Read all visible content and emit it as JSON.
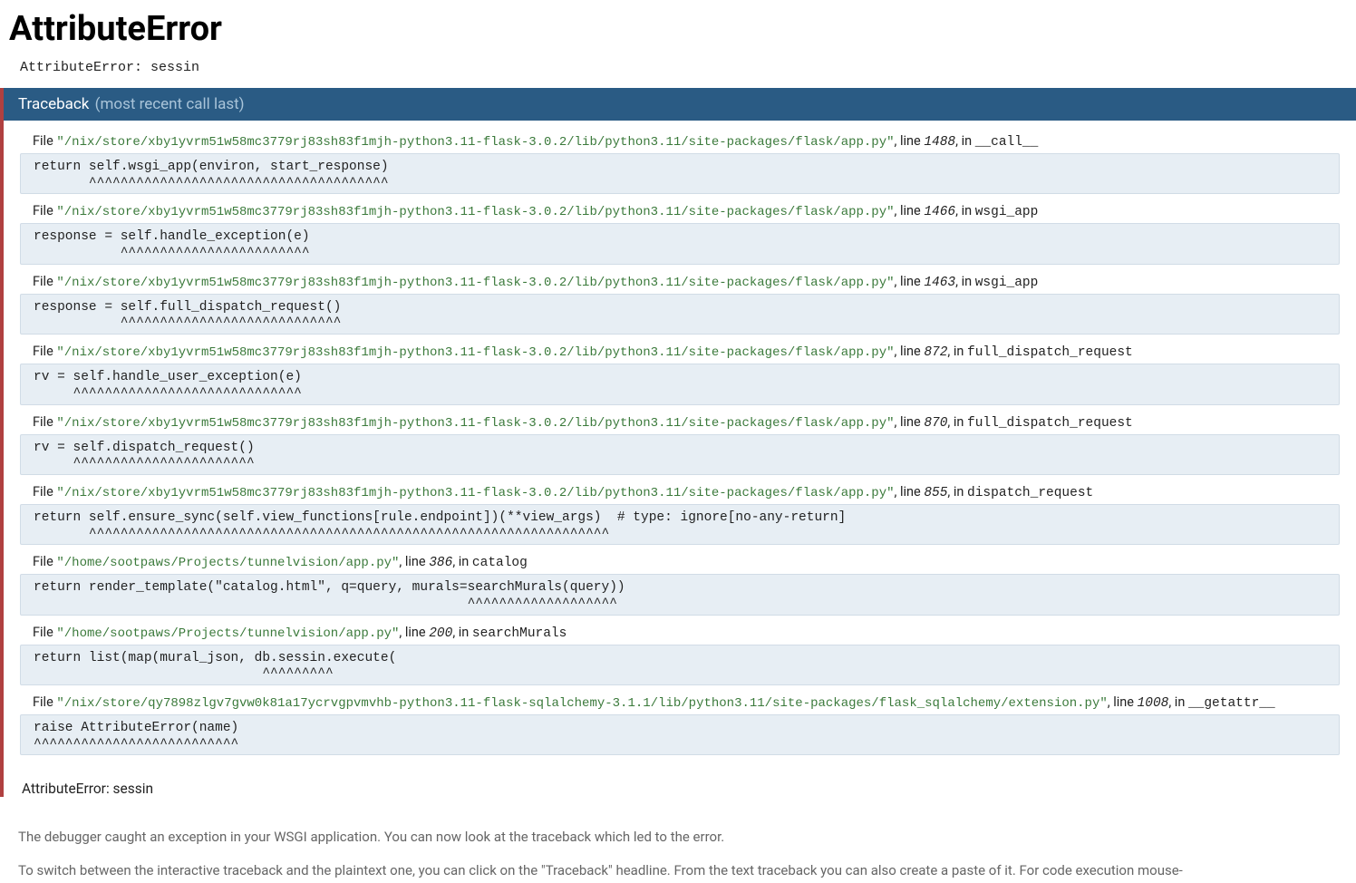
{
  "title": "AttributeError",
  "error_summary": "AttributeError: sessin",
  "traceback_header_label": "Traceback",
  "traceback_header_recent": "(most recent call last)",
  "final_error": "AttributeError: sessin",
  "footer_p1": "The debugger caught an exception in your WSGI application. You can now look at the traceback which led to the error.",
  "footer_p2": "To switch between the interactive traceback and the plaintext one, you can click on the \"Traceback\" headline. From the text traceback you can also create a paste of it. For code execution mouse-",
  "frames": [
    {
      "path": "\"/nix/store/xby1yvrm51w58mc3779rj83sh83f1mjh-python3.11-flask-3.0.2/lib/python3.11/site-packages/flask/app.py\"",
      "line": "1488",
      "func": "__call__",
      "code": "return self.wsgi_app(environ, start_response)\n       ^^^^^^^^^^^^^^^^^^^^^^^^^^^^^^^^^^^^^^"
    },
    {
      "path": "\"/nix/store/xby1yvrm51w58mc3779rj83sh83f1mjh-python3.11-flask-3.0.2/lib/python3.11/site-packages/flask/app.py\"",
      "line": "1466",
      "func": "wsgi_app",
      "code": "response = self.handle_exception(e)\n           ^^^^^^^^^^^^^^^^^^^^^^^^"
    },
    {
      "path": "\"/nix/store/xby1yvrm51w58mc3779rj83sh83f1mjh-python3.11-flask-3.0.2/lib/python3.11/site-packages/flask/app.py\"",
      "line": "1463",
      "func": "wsgi_app",
      "code": "response = self.full_dispatch_request()\n           ^^^^^^^^^^^^^^^^^^^^^^^^^^^^"
    },
    {
      "path": "\"/nix/store/xby1yvrm51w58mc3779rj83sh83f1mjh-python3.11-flask-3.0.2/lib/python3.11/site-packages/flask/app.py\"",
      "line": "872",
      "func": "full_dispatch_request",
      "code": "rv = self.handle_user_exception(e)\n     ^^^^^^^^^^^^^^^^^^^^^^^^^^^^^"
    },
    {
      "path": "\"/nix/store/xby1yvrm51w58mc3779rj83sh83f1mjh-python3.11-flask-3.0.2/lib/python3.11/site-packages/flask/app.py\"",
      "line": "870",
      "func": "full_dispatch_request",
      "code": "rv = self.dispatch_request()\n     ^^^^^^^^^^^^^^^^^^^^^^^"
    },
    {
      "path": "\"/nix/store/xby1yvrm51w58mc3779rj83sh83f1mjh-python3.11-flask-3.0.2/lib/python3.11/site-packages/flask/app.py\"",
      "line": "855",
      "func": "dispatch_request",
      "code": "return self.ensure_sync(self.view_functions[rule.endpoint])(**view_args)  # type: ignore[no-any-return]\n       ^^^^^^^^^^^^^^^^^^^^^^^^^^^^^^^^^^^^^^^^^^^^^^^^^^^^^^^^^^^^^^^^^^"
    },
    {
      "path": "\"/home/sootpaws/Projects/tunnelvision/app.py\"",
      "line": "386",
      "func": "catalog",
      "code": "return render_template(\"catalog.html\", q=query, murals=searchMurals(query))\n                                                       ^^^^^^^^^^^^^^^^^^^"
    },
    {
      "path": "\"/home/sootpaws/Projects/tunnelvision/app.py\"",
      "line": "200",
      "func": "searchMurals",
      "code": "return list(map(mural_json, db.sessin.execute(\n                             ^^^^^^^^^"
    },
    {
      "path": "\"/nix/store/qy7898zlgv7gvw0k81a17ycrvgpvmvhb-python3.11-flask-sqlalchemy-3.1.1/lib/python3.11/site-packages/flask_sqlalchemy/extension.py\"",
      "line": "1008",
      "func": "__getattr__",
      "code": "raise AttributeError(name)\n^^^^^^^^^^^^^^^^^^^^^^^^^^"
    }
  ]
}
